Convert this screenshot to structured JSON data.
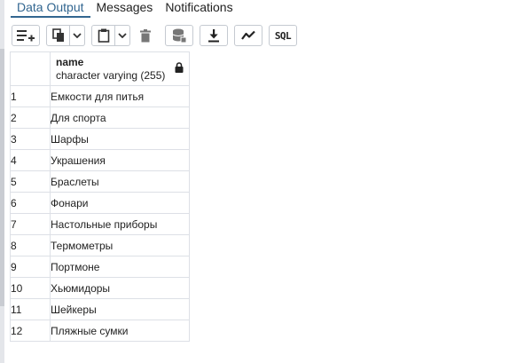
{
  "tabs": [
    {
      "label": "Data Output",
      "active": true
    },
    {
      "label": "Messages",
      "active": false
    },
    {
      "label": "Notifications",
      "active": false
    }
  ],
  "toolbar": {
    "sql_label": "SQL"
  },
  "column": {
    "name": "name",
    "type": "character varying (255)"
  },
  "rows": [
    {
      "num": "1",
      "value": "Емкости для питья"
    },
    {
      "num": "2",
      "value": "Для спорта"
    },
    {
      "num": "3",
      "value": "Шарфы"
    },
    {
      "num": "4",
      "value": "Украшения"
    },
    {
      "num": "5",
      "value": "Браслеты"
    },
    {
      "num": "6",
      "value": "Фонари"
    },
    {
      "num": "7",
      "value": "Настольные приборы"
    },
    {
      "num": "8",
      "value": "Термометры"
    },
    {
      "num": "9",
      "value": "Портмоне"
    },
    {
      "num": "10",
      "value": "Хьюмидоры"
    },
    {
      "num": "11",
      "value": "Шейкеры"
    },
    {
      "num": "12",
      "value": "Пляжные сумки"
    }
  ],
  "colors": {
    "accent": "#326690",
    "border": "#dde0e6"
  }
}
